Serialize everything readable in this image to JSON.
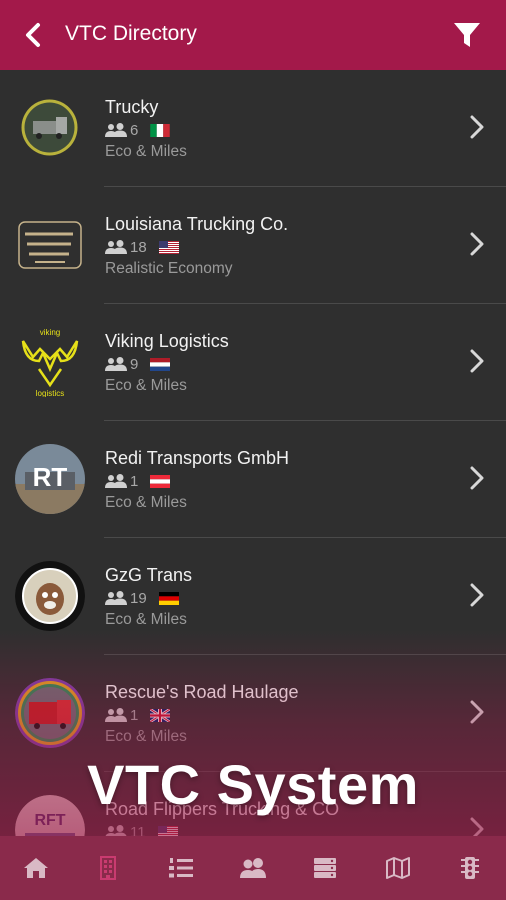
{
  "header": {
    "title": "VTC Directory"
  },
  "vtcs": [
    {
      "name": "Trucky",
      "members": "6",
      "country": "italy",
      "mode": "Eco & Miles"
    },
    {
      "name": "Louisiana Trucking Co.",
      "members": "18",
      "country": "usa",
      "mode": "Realistic Economy"
    },
    {
      "name": "Viking Logistics",
      "members": "9",
      "country": "netherlands",
      "mode": "Eco & Miles",
      "logo_text_top": "viking",
      "logo_text_bottom": "logistics"
    },
    {
      "name": "Redi Transports GmbH",
      "members": "1",
      "country": "austria",
      "mode": "Eco & Miles",
      "logo_text": "RT"
    },
    {
      "name": "GzG Trans",
      "members": "19",
      "country": "germany",
      "mode": "Eco & Miles"
    },
    {
      "name": "Rescue's Road Haulage",
      "members": "1",
      "country": "uk",
      "mode": "Eco & Miles"
    },
    {
      "name": "Road Flippers Trucking & CO",
      "members": "11",
      "country": "usa",
      "logo_text": "RFT"
    }
  ],
  "overlay": {
    "caption": "VTC System"
  },
  "icons": {
    "back": "chevron-left-icon",
    "filter": "filter-icon",
    "row_arrow": "chevron-right-icon",
    "members": "users-icon"
  },
  "bottom_nav": [
    {
      "icon": "home-icon"
    },
    {
      "icon": "building-icon",
      "active": true
    },
    {
      "icon": "ordered-list-icon"
    },
    {
      "icon": "users-icon"
    },
    {
      "icon": "server-icon"
    },
    {
      "icon": "map-icon"
    },
    {
      "icon": "traffic-light-icon"
    }
  ],
  "colors": {
    "header": "#a3194a",
    "background": "#2f2f2f",
    "nav": "#8a2a4b",
    "active_nav_icon": "#c93b70",
    "nav_icon": "#d9b9c5"
  }
}
